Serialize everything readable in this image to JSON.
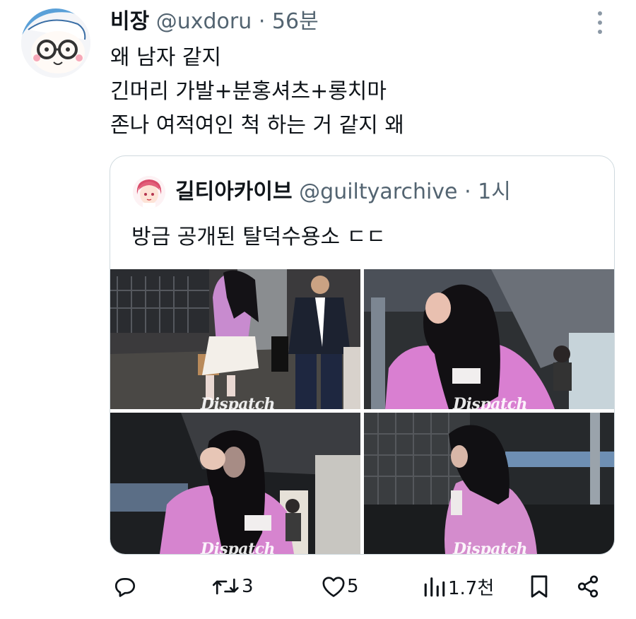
{
  "tweet": {
    "author_name": "비장",
    "author_handle": "@uxdoru",
    "separator": "·",
    "time": "56분",
    "text_lines": [
      "왜 남자 같지",
      "긴머리 가발+분홍셔츠+롱치마",
      "존나 여적여인 척 하는 거 같지 왜"
    ]
  },
  "quote": {
    "author_name": "길티아카이브",
    "author_handle": "@guiltyarchive",
    "separator": "·",
    "time": "1시",
    "text": "방금 공개된 탈덕수용소 ㄷㄷ",
    "watermark": "Dispatch"
  },
  "actions": {
    "reply_count": "",
    "retweet_count": "3",
    "like_count": "5",
    "views_count": "1.7천"
  },
  "icons": {
    "more": "more-vertical-icon",
    "reply": "reply-icon",
    "retweet": "retweet-icon",
    "like": "heart-icon",
    "views": "views-icon",
    "bookmark": "bookmark-icon",
    "share": "share-icon"
  },
  "colors": {
    "text_primary": "#0f1419",
    "text_secondary": "#536471",
    "border": "#cfd9de"
  }
}
